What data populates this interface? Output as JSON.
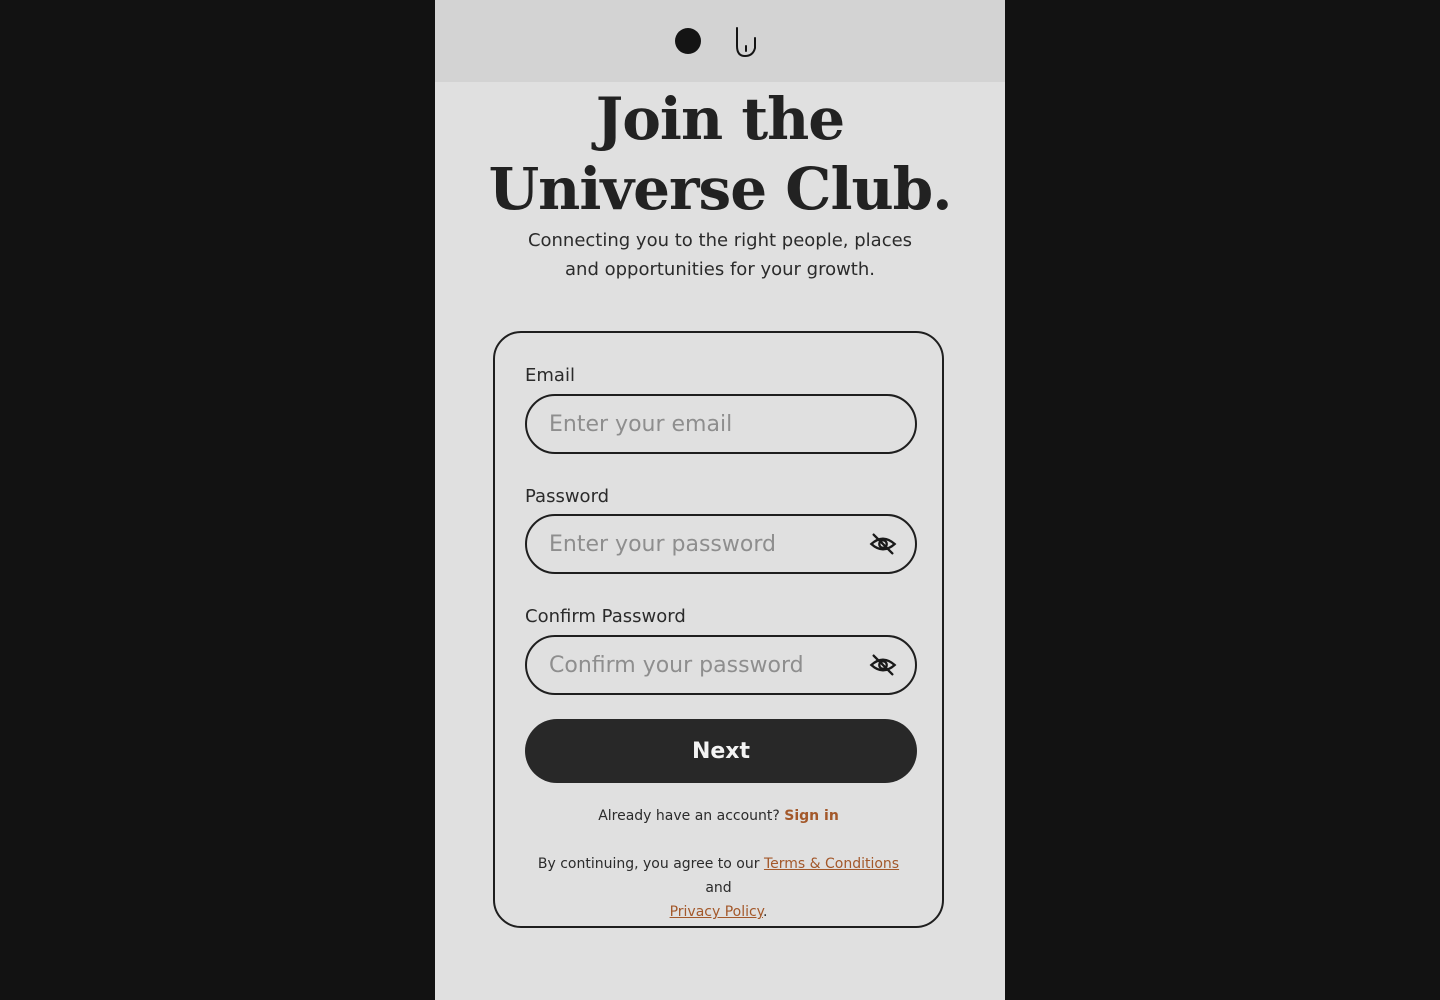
{
  "header": {
    "logo_dot_icon": "circle-dot-icon",
    "logo_mark_icon": "hook-u-logo-icon"
  },
  "hero": {
    "title_line1": "Join the",
    "title_line2": "Universe Club.",
    "subtitle_line1": "Connecting you to the right people, places",
    "subtitle_line2": "and opportunities for your growth."
  },
  "form": {
    "email": {
      "label": "Email",
      "placeholder": "Enter your email",
      "value": ""
    },
    "password": {
      "label": "Password",
      "placeholder": "Enter your password",
      "value": "",
      "toggle_icon": "eye-off-icon"
    },
    "confirm": {
      "label": "Confirm Password",
      "placeholder": "Confirm your password",
      "value": "",
      "toggle_icon": "eye-off-icon"
    },
    "next_label": "Next"
  },
  "signin": {
    "prompt": "Already have an account?",
    "link_label": "Sign in"
  },
  "legal": {
    "prefix": "By continuing, you agree to our",
    "terms_label": "Terms & Conditions",
    "conjunction": "and",
    "privacy_label": "Privacy Policy",
    "suffix": "."
  },
  "colors": {
    "page_background": "#121212",
    "screen_background": "#e0e0e0",
    "header_background": "#d3d3d3",
    "primary_button": "#282828",
    "accent_link": "#a3582a"
  }
}
